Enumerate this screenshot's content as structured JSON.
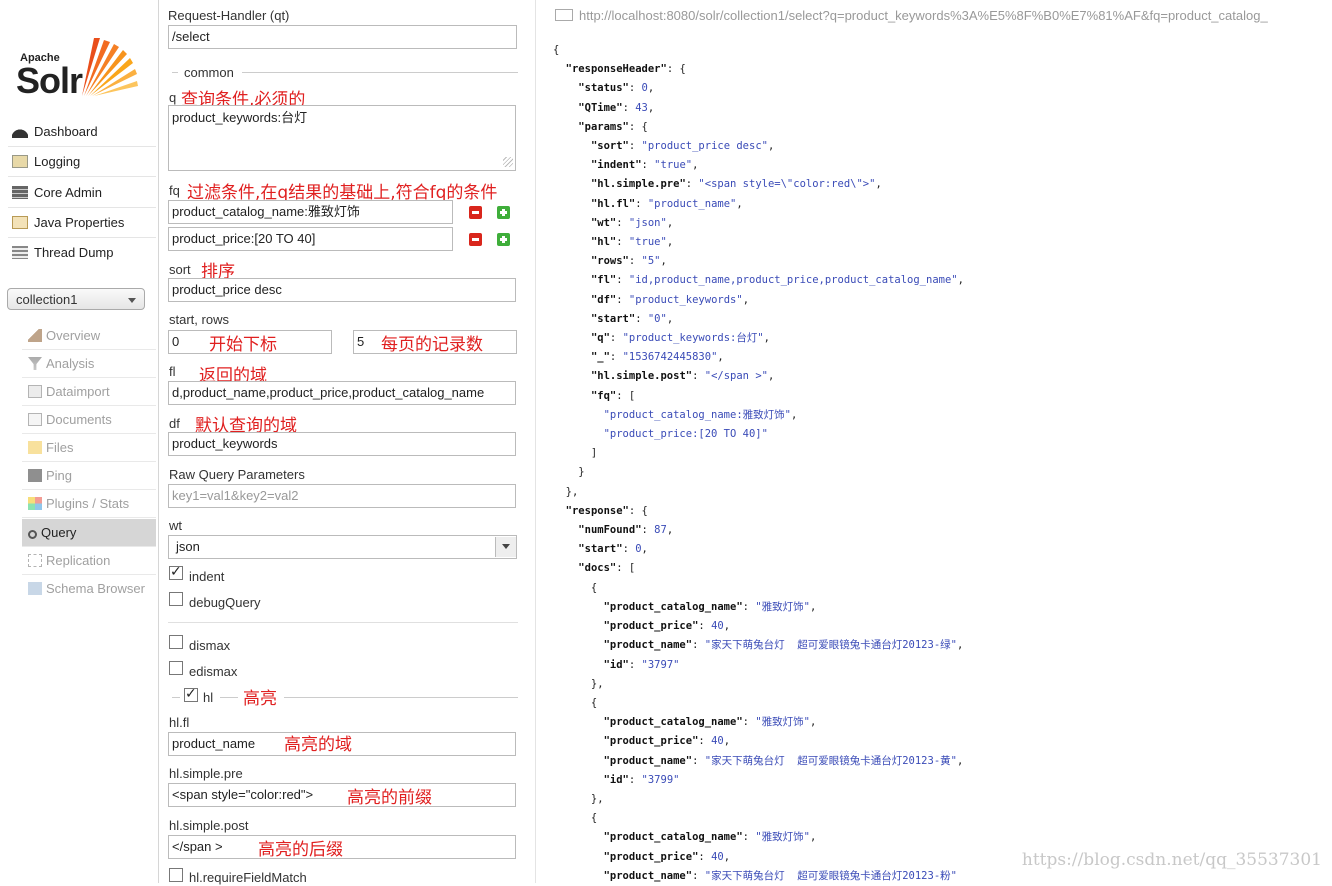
{
  "sidebar": {
    "logo": {
      "top": "Apache",
      "main": "Solr"
    },
    "nav": [
      "Dashboard",
      "Logging",
      "Core Admin",
      "Java Properties",
      "Thread Dump"
    ],
    "core_select": "collection1",
    "core_menu": [
      "Overview",
      "Analysis",
      "Dataimport",
      "Documents",
      "Files",
      "Ping",
      "Plugins / Stats",
      "Query",
      "Replication",
      "Schema Browser"
    ],
    "active_item": "Query"
  },
  "form": {
    "qt_label": "Request-Handler (qt)",
    "qt_value": "/select",
    "common_label": "common",
    "q_label": "q",
    "q_note": "查询条件,必须的",
    "q_value": "product_keywords:台灯",
    "fq_label": "fq",
    "fq_note": "过滤条件,在q结果的基础上,符合fq的条件",
    "fq_values": [
      "product_catalog_name:雅致灯饰",
      "product_price:[20 TO 40]"
    ],
    "sort_label": "sort",
    "sort_note": "排序",
    "sort_value": "product_price desc",
    "start_rows_label": "start, rows",
    "start_value": "0",
    "start_note": "开始下标",
    "rows_value": "5",
    "rows_note": "每页的记录数",
    "fl_label": "fl",
    "fl_note": "返回的域",
    "fl_value": "d,product_name,product_price,product_catalog_name",
    "df_label": "df",
    "df_note": "默认查询的域",
    "df_value": "product_keywords",
    "raw_label": "Raw Query Parameters",
    "raw_placeholder": "key1=val1&key2=val2",
    "wt_label": "wt",
    "wt_value": "json",
    "indent_label": "indent",
    "indent_checked": true,
    "debug_label": "debugQuery",
    "debug_checked": false,
    "dismax_label": "dismax",
    "edismax_label": "edismax",
    "hl_label": "hl",
    "hl_checked": true,
    "hl_note": "高亮",
    "hlfl_label": "hl.fl",
    "hlfl_value": "product_name",
    "hlfl_note": "高亮的域",
    "pre_label": "hl.simple.pre",
    "pre_value": "<span style=\"color:red\">",
    "pre_note": "高亮的前缀",
    "post_label": "hl.simple.post",
    "post_value": "</span >",
    "post_note": "高亮的后缀",
    "req_field_label": "hl.requireFieldMatch"
  },
  "response": {
    "url": "http://localhost:8080/solr/collection1/select?q=product_keywords%3A%E5%8F%B0%E7%81%AF&fq=product_catalog_",
    "header": {
      "status": 0,
      "QTime": 43,
      "params": [
        [
          "sort",
          "product_price desc"
        ],
        [
          "indent",
          "true"
        ],
        [
          "hl.simple.pre",
          "<span style=\\\"color:red\\\">"
        ],
        [
          "hl.fl",
          "product_name"
        ],
        [
          "wt",
          "json"
        ],
        [
          "hl",
          "true"
        ],
        [
          "rows",
          "5"
        ],
        [
          "fl",
          "id,product_name,product_price,product_catalog_name"
        ],
        [
          "df",
          "product_keywords"
        ],
        [
          "start",
          "0"
        ],
        [
          "q",
          "product_keywords:台灯"
        ],
        [
          "_",
          "1536742445830"
        ],
        [
          "hl.simple.post",
          "</span >"
        ]
      ],
      "fq": [
        "product_catalog_name:雅致灯饰",
        "product_price:[20 TO 40]"
      ]
    },
    "numFound": 87,
    "start": 0,
    "docs": [
      {
        "product_catalog_name": "雅致灯饰",
        "product_price": 40,
        "product_name": "家天下萌兔台灯  超可爱眼镜兔卡通台灯20123-绿",
        "id": "3797"
      },
      {
        "product_catalog_name": "雅致灯饰",
        "product_price": 40,
        "product_name": "家天下萌兔台灯  超可爱眼镜兔卡通台灯20123-黄",
        "id": "3799"
      },
      {
        "product_catalog_name": "雅致灯饰",
        "product_price": 40,
        "product_name": "家天下萌兔台灯  超可爱眼镜兔卡通台灯20123-粉"
      }
    ]
  },
  "watermark": "https://blog.csdn.net/qq_35537301"
}
